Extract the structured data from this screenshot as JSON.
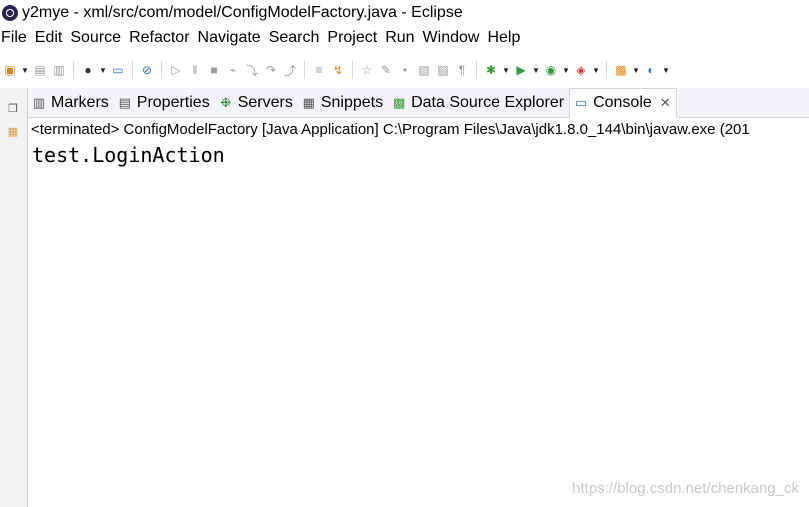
{
  "window": {
    "title": "y2mye - xml/src/com/model/ConfigModelFactory.java - Eclipse"
  },
  "menu": [
    "File",
    "Edit",
    "Source",
    "Refactor",
    "Navigate",
    "Search",
    "Project",
    "Run",
    "Window",
    "Help"
  ],
  "tabs": [
    {
      "label": "Markers",
      "icon": "markers-icon"
    },
    {
      "label": "Properties",
      "icon": "properties-icon"
    },
    {
      "label": "Servers",
      "icon": "servers-icon"
    },
    {
      "label": "Snippets",
      "icon": "snippets-icon"
    },
    {
      "label": "Data Source Explorer",
      "icon": "data-source-explorer-icon"
    },
    {
      "label": "Console",
      "icon": "console-icon",
      "active": true
    }
  ],
  "console": {
    "status": "<terminated> ConfigModelFactory [Java Application] C:\\Program Files\\Java\\jdk1.8.0_144\\bin\\javaw.exe (201",
    "output": "test.LoginAction"
  },
  "watermark": "https://blog.csdn.net/chenkang_ck",
  "colors": {
    "tab_active_bg": "#ffffff",
    "tabstrip_bg": "#f2f4f7",
    "leftbar_bg": "#f2f2f2"
  }
}
